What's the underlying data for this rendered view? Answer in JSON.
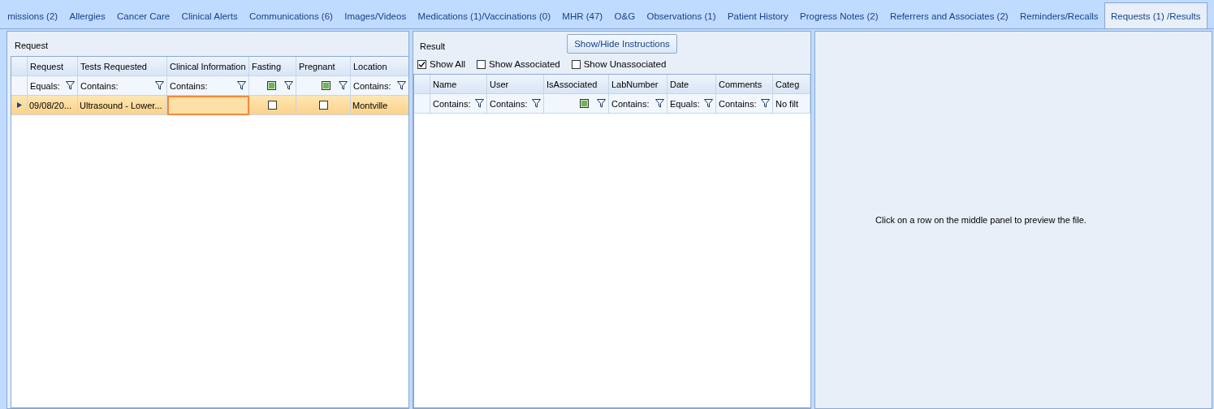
{
  "tabs": [
    {
      "label": "missions (2)",
      "selected": false
    },
    {
      "label": "Allergies",
      "selected": false
    },
    {
      "label": "Cancer Care",
      "selected": false
    },
    {
      "label": "Clinical Alerts",
      "selected": false
    },
    {
      "label": "Communications (6)",
      "selected": false
    },
    {
      "label": "Images/Videos",
      "selected": false
    },
    {
      "label": "Medications (1)/Vaccinations (0)",
      "selected": false
    },
    {
      "label": "MHR (47)",
      "selected": false
    },
    {
      "label": "O&G",
      "selected": false
    },
    {
      "label": "Observations (1)",
      "selected": false
    },
    {
      "label": "Patient History",
      "selected": false
    },
    {
      "label": "Progress Notes (2)",
      "selected": false
    },
    {
      "label": "Referrers and Associates (2)",
      "selected": false
    },
    {
      "label": "Reminders/Recalls",
      "selected": false
    },
    {
      "label": "Requests (1) /Results",
      "selected": true
    }
  ],
  "request": {
    "title": "Request",
    "grid": {
      "columns": [
        "Request",
        "Tests Requested",
        "Clinical Information",
        "Fasting",
        "Pregnant",
        "Location"
      ],
      "filters": [
        {
          "kind": "text",
          "text": "Equals:"
        },
        {
          "kind": "text",
          "text": "Contains:"
        },
        {
          "kind": "text",
          "text": "Contains:"
        },
        {
          "kind": "check",
          "indeterminate": true
        },
        {
          "kind": "check",
          "indeterminate": true
        },
        {
          "kind": "text",
          "text": "Contains:"
        }
      ],
      "rows": [
        {
          "selected": true,
          "cells": [
            {
              "kind": "text",
              "text": "09/08/20...",
              "focused": false
            },
            {
              "kind": "text",
              "text": "Ultrasound - Lower...",
              "focused": false
            },
            {
              "kind": "edit",
              "focused": true
            },
            {
              "kind": "check",
              "checked": false,
              "focused": false
            },
            {
              "kind": "check",
              "checked": false,
              "focused": false
            },
            {
              "kind": "text",
              "text": "Montville",
              "focused": false
            }
          ]
        }
      ]
    }
  },
  "result": {
    "title": "Result",
    "button": "Show/Hide Instructions",
    "options": [
      {
        "label": "Show All",
        "checked": true
      },
      {
        "label": "Show Associated",
        "checked": false
      },
      {
        "label": "Show Unassociated",
        "checked": false
      }
    ],
    "grid": {
      "columns": [
        "Name",
        "User",
        "IsAssociated",
        "LabNumber",
        "Date",
        "Comments",
        "Categ"
      ],
      "filters": [
        {
          "kind": "text",
          "text": "Contains:"
        },
        {
          "kind": "text",
          "text": "Contains:"
        },
        {
          "kind": "check",
          "indeterminate": true
        },
        {
          "kind": "text",
          "text": "Contains:"
        },
        {
          "kind": "text",
          "text": "Equals:"
        },
        {
          "kind": "text",
          "text": "Contains:"
        },
        {
          "kind": "plain",
          "text": "No filt"
        }
      ]
    }
  },
  "preview": {
    "message": "Click on a row on the middle panel to preview the file."
  }
}
